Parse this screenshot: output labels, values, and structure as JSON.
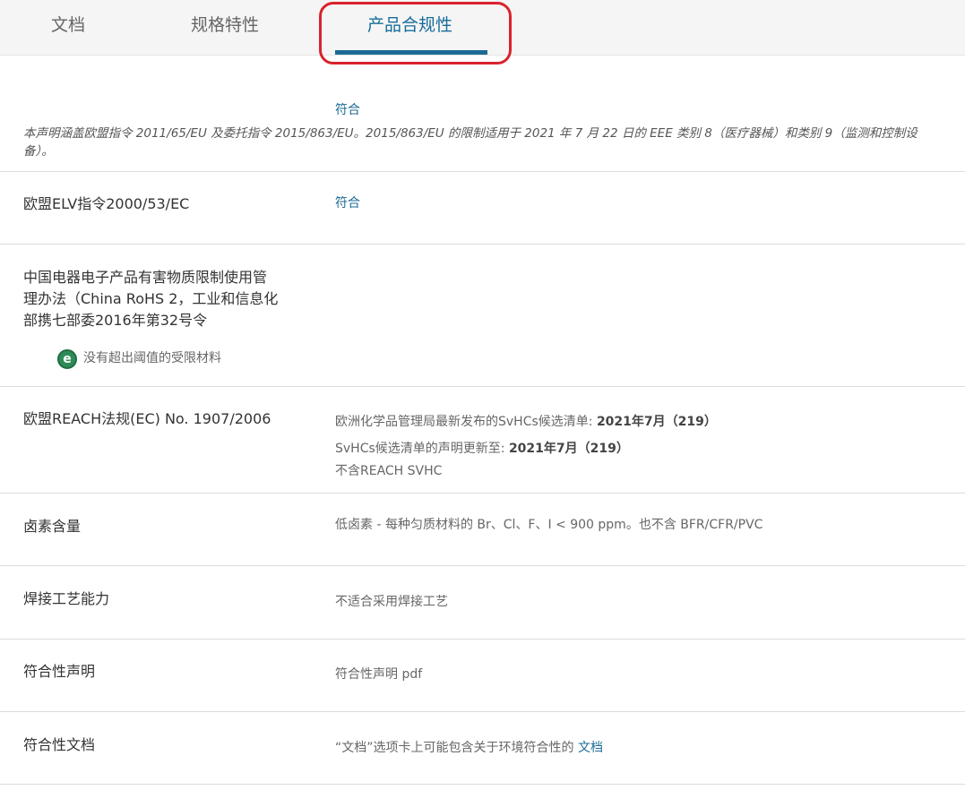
{
  "tabs": [
    {
      "label": "文档"
    },
    {
      "label": "规格特性"
    },
    {
      "label": "产品合规性"
    }
  ],
  "rohs_eu": {
    "status": "符合",
    "note": "本声明涵盖欧盟指令 2011/65/EU 及委托指令 2015/863/EU。2015/863/EU 的限制适用于 2021 年 7 月 22 日的 EEE 类别 8（医疗器械）和类别 9（监测和控制设备）。"
  },
  "elv": {
    "label": "欧盟ELV指令2000/53/EC",
    "status": "符合"
  },
  "china_rohs": {
    "label_lines": [
      "中国电器电子产品有害物质限制使用管",
      "理办法（China RoHS 2，工业和信息化",
      "部携七部委2016年第32号令"
    ],
    "badge_icon": "e-environment-icon",
    "badge_color": "#2e8b57",
    "badge_text": "没有超出阈值的受限材料"
  },
  "reach": {
    "label": "欧盟REACH法规(EC) No. 1907/2006",
    "line1_prefix": "欧洲化学品管理局最新发布的SvHCs候选清单: ",
    "line1_bold": "2021年7月（219）",
    "line2_prefix": "SvHCs候选清单的声明更新至: ",
    "line2_bold": "2021年7月（219）",
    "line3": "不含REACH SVHC"
  },
  "halogen": {
    "label": "卤素含量",
    "value": "低卤素 - 每种匀质材料的 Br、Cl、F、I < 900 ppm。也不含 BFR/CFR/PVC"
  },
  "solder": {
    "label": "焊接工艺能力",
    "value": "不适合采用焊接工艺"
  },
  "declaration": {
    "label": "符合性声明",
    "value": "符合性声明 pdf"
  },
  "compliance_docs": {
    "label": "符合性文档",
    "text": "“文档”选项卡上可能包含关于环境符合性的 ",
    "link": "文档"
  },
  "colors": {
    "accent": "#1c6b94",
    "highlight": "#d9232d"
  }
}
